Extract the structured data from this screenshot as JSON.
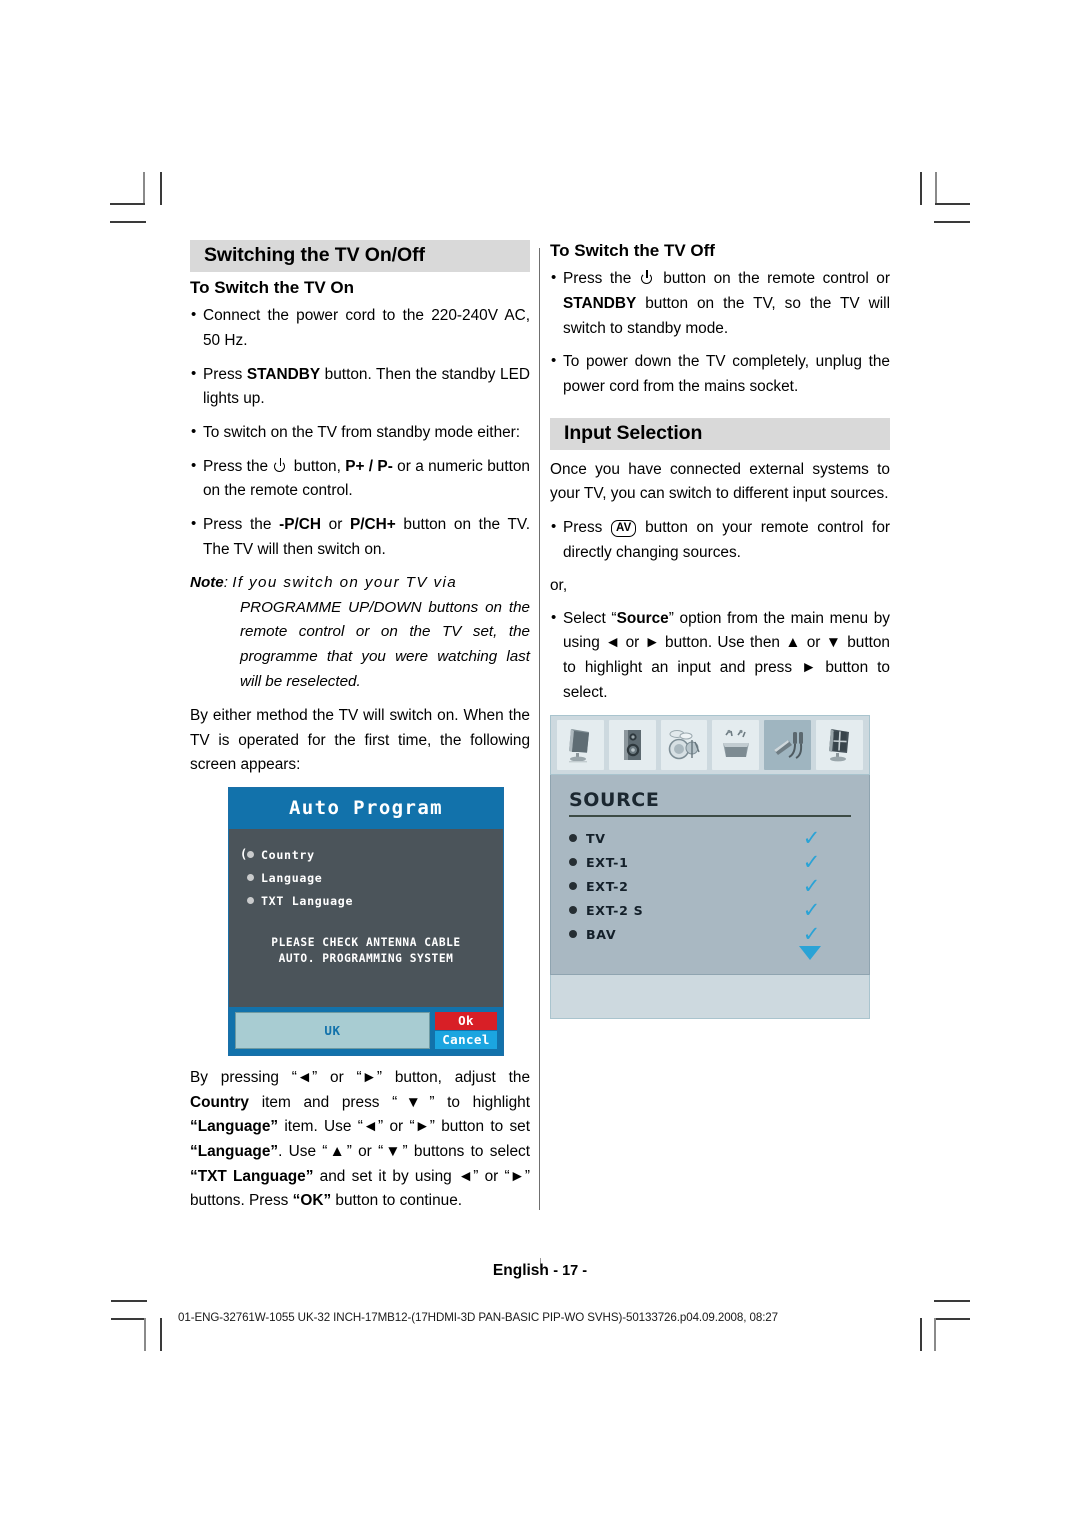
{
  "document": {
    "footer_language": "English",
    "footer_page": "- 17 -",
    "doc_code": "01-ENG-32761W-1055 UK-32 INCH-17MB12-(17HDMI-3D PAN-BASIC PIP-WO SVHS)-50133726.p04.09.2008, 08:27"
  },
  "left_column": {
    "section_title": "Switching the TV On/Off",
    "subhead": "To Switch the TV On",
    "bullet_1": "Connect the power cord to the 220-240V AC, 50 Hz.",
    "bullet_2_pre": "Press ",
    "bullet_2_bold": "STANDBY",
    "bullet_2_post": " button. Then the standby LED lights up.",
    "bullet_3": "To switch on the TV from standby mode either:",
    "bullet_4_pre": "Press the ",
    "bullet_4_mid": " button, ",
    "bullet_4_bold": "P+ / P-",
    "bullet_4_post": " or a numeric button on the remote control.",
    "bullet_5_pre": "Press the ",
    "bullet_5_bold_a": "-P/CH",
    "bullet_5_mid": " or ",
    "bullet_5_bold_b": "P/CH+",
    "bullet_5_post": " button on the TV. The TV will then switch on.",
    "note_label": "Note",
    "note_colon": ": ",
    "note_line1": "If you switch on your TV via",
    "note_body": "PROGRAMME UP/DOWN buttons on the remote control or on the TV set, the programme that you were watching last will be reselected.",
    "paragraph_after_note": "By either method the TV will switch on. When the TV is operated for the first time, the following screen appears:",
    "paragraph_final": {
      "t1": "By pressing “◄” or “►” button, adjust the ",
      "b1": "Country",
      "t2": " item and press “▼” to highlight ",
      "b2": "“Language”",
      "t3": " item. Use “◄” or “►” button to set ",
      "b3": "“Language”",
      "t4": ". Use “▲” or “▼” buttons to select ",
      "b4": "“TXT Language”",
      "t5": " and set it by using ◄” or “►” buttons. Press ",
      "b5": "“OK”",
      "t6": " button to continue."
    }
  },
  "right_column": {
    "subhead": "To Switch the TV Off",
    "bullet_1_pre": "Press the ",
    "bullet_1_mid": " button on the remote control  or ",
    "bullet_1_bold": "STANDBY",
    "bullet_1_post": " button on the TV, so the TV will switch to standby mode.",
    "bullet_2": "To power down the TV completely, unplug the power cord from the mains socket.",
    "section_title": "Input Selection",
    "intro": "Once you have connected external systems to your TV, you can switch to different input sources.",
    "bullet_av_pre": "Press ",
    "bullet_av_key": "AV",
    "bullet_av_post": " button on your remote control for directly changing sources.",
    "or_text": "or,",
    "bullet_source_pre": "Select “",
    "bullet_source_bold": "Source",
    "bullet_source_post": "” option from the main menu by using ◄ or ► button. Use then ▲ or ▼ button to highlight an input and press ► button to select."
  },
  "auto_program_osd": {
    "title": "Auto Program",
    "items": [
      "Country",
      "Language",
      "TXT Language"
    ],
    "message_line1": "PLEASE CHECK ANTENNA CABLE",
    "message_line2": "AUTO. PROGRAMMING SYSTEM",
    "country_value": "UK",
    "ok_label": "Ok",
    "cancel_label": "Cancel",
    "colors": {
      "title_bar": "#1272ab",
      "body": "#4b545a",
      "ok": "#d81f26",
      "cancel": "#1ba5e0",
      "field": "#a8ccd2"
    }
  },
  "source_osd": {
    "title": "SOURCE",
    "icons": [
      {
        "name": "picture-tv-icon",
        "active": false
      },
      {
        "name": "speaker-icon",
        "active": false
      },
      {
        "name": "drums-sound-icon",
        "active": false
      },
      {
        "name": "toolbox-feature-icon",
        "active": false
      },
      {
        "name": "cables-source-icon",
        "active": true
      },
      {
        "name": "screen-install-icon",
        "active": false
      }
    ],
    "rows": [
      {
        "label": "TV",
        "checked": true
      },
      {
        "label": "EXT-1",
        "checked": true
      },
      {
        "label": "EXT-2",
        "checked": true
      },
      {
        "label": "EXT-2 S",
        "checked": true
      },
      {
        "label": "BAV",
        "checked": true
      }
    ],
    "more_indicator": "▼",
    "check_glyph": "✓",
    "colors": {
      "panel": "#a9b8c2",
      "iconbar": "#cdd9df",
      "check": "#2aa3d6"
    }
  }
}
